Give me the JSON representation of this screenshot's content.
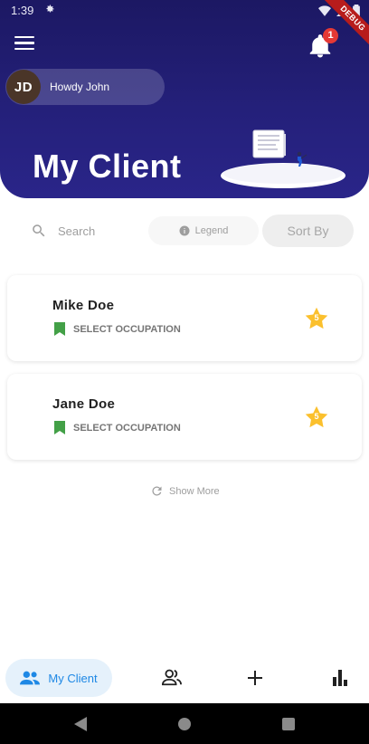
{
  "status_bar": {
    "time": "1:39"
  },
  "debug_ribbon": "DEBUG",
  "notifications": {
    "count": "1"
  },
  "user": {
    "initials": "JD",
    "greeting": "Howdy John"
  },
  "page": {
    "title": "My Client"
  },
  "toolbar": {
    "search_label": "Search",
    "legend_label": "Legend",
    "sort_label": "Sort By"
  },
  "clients": [
    {
      "name": "Mike Doe",
      "occupation": "SELECT OCCUPATION",
      "rating": "5"
    },
    {
      "name": "Jane Doe",
      "occupation": "SELECT OCCUPATION",
      "rating": "5"
    }
  ],
  "show_more": "Show More",
  "bottom_nav": {
    "active_label": "My Client",
    "items": [
      "clients-icon",
      "people-icon",
      "add-icon",
      "stats-icon"
    ]
  },
  "colors": {
    "header": "#24207a",
    "accent": "#1e88e5",
    "star": "#fbc02d",
    "bookmark": "#43a047",
    "badge": "#e53935"
  }
}
